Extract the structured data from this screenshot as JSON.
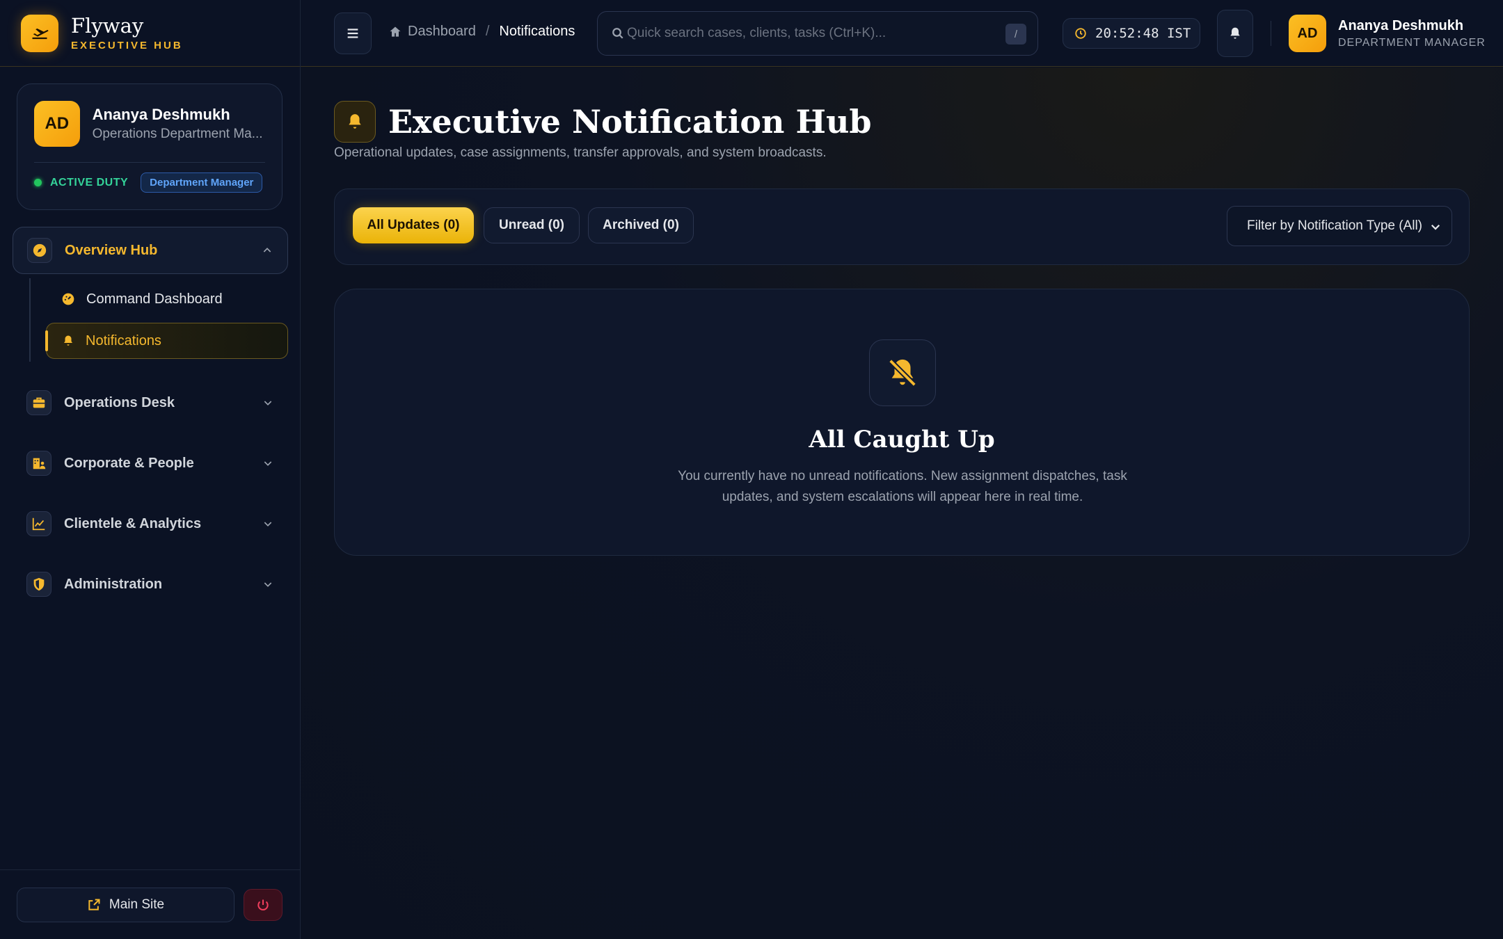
{
  "brand": {
    "title": "Flyway",
    "subtitle": "EXECUTIVE HUB"
  },
  "profile": {
    "initials": "AD",
    "name": "Ananya Deshmukh",
    "role": "Operations Department Ma...",
    "status": "ACTIVE DUTY",
    "badge": "Department Manager"
  },
  "sidebar": {
    "groups": [
      {
        "label": "Overview Hub",
        "icon": "compass-icon",
        "open": true,
        "items": [
          {
            "label": "Command Dashboard",
            "icon": "gauge-icon"
          },
          {
            "label": "Notifications",
            "icon": "bell-icon",
            "active": true
          }
        ]
      },
      {
        "label": "Operations Desk",
        "icon": "briefcase-icon"
      },
      {
        "label": "Corporate & People",
        "icon": "building-people-icon"
      },
      {
        "label": "Clientele & Analytics",
        "icon": "chart-line-icon"
      },
      {
        "label": "Administration",
        "icon": "shield-icon"
      }
    ],
    "footer": {
      "main_site": "Main Site"
    }
  },
  "topbar": {
    "breadcrumb": {
      "home": "Dashboard",
      "current": "Notifications"
    },
    "search_placeholder": "Quick search cases, clients, tasks (Ctrl+K)...",
    "search_shortcut": "/",
    "clock": "20:52:48 IST",
    "user": {
      "initials": "AD",
      "name": "Ananya Deshmukh",
      "role": "DEPARTMENT MANAGER"
    }
  },
  "main": {
    "title": "Executive Notification Hub",
    "subtitle": "Operational updates, case assignments, transfer approvals, and system broadcasts.",
    "tabs": [
      {
        "label": "All Updates (0)",
        "active": true
      },
      {
        "label": "Unread (0)"
      },
      {
        "label": "Archived (0)"
      }
    ],
    "filter": "Filter by Notification Type (All)",
    "empty": {
      "title": "All Caught Up",
      "description": "You currently have no unread notifications. New assignment dispatches, task updates, and system escalations will appear here in real time."
    }
  },
  "colors": {
    "accent": "#f5b82e",
    "background": "#0b1120",
    "panel": "#0f172b",
    "success": "#22c55e",
    "info": "#60a5fa"
  }
}
